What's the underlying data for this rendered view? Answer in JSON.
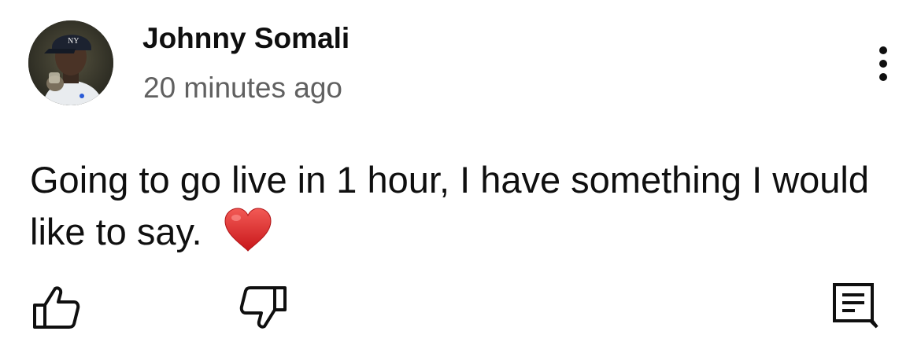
{
  "post": {
    "author": "Johnny Somali",
    "timestamp": "20 minutes ago",
    "text": "Going to go live in 1 hour, I have something I would like to say.",
    "emoji": "heart-icon"
  },
  "icons": {
    "more": "more-vert-icon",
    "like": "thumbs-up-icon",
    "dislike": "thumbs-down-icon",
    "reply": "comment-icon"
  },
  "colors": {
    "text": "#0f0f0f",
    "secondary_text": "#606060",
    "heart": "#e0201f"
  }
}
